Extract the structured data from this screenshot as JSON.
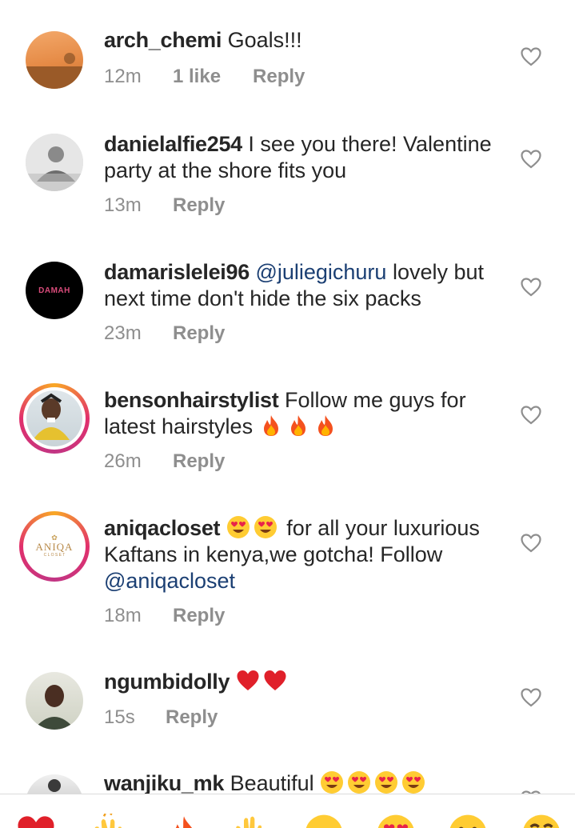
{
  "comments": [
    {
      "username": "arch_chemi",
      "text": "Goals!!!",
      "time": "12m",
      "likes": "1 like",
      "reply": "Reply"
    },
    {
      "username": "danielalfie254",
      "text": "I see you there! Valentine party at the shore fits you",
      "time": "13m",
      "reply": "Reply"
    },
    {
      "username": "damarislelei96",
      "mention": "@juliegichuru",
      "text": "lovely but next time don't hide the six packs",
      "time": "23m",
      "reply": "Reply",
      "avatar_label": "DAMAH"
    },
    {
      "username": "bensonhairstylist",
      "text": "Follow me guys for latest hairstyles",
      "time": "26m",
      "reply": "Reply"
    },
    {
      "username": "aniqacloset",
      "text": "for all your luxurious Kaftans in kenya,we gotcha! Follow",
      "mention": "@aniqacloset",
      "time": "18m",
      "reply": "Reply",
      "avatar_label": "ANIQA",
      "avatar_sub": "C L O S E T"
    },
    {
      "username": "ngumbidolly",
      "time": "15s",
      "reply": "Reply"
    },
    {
      "username": "wanjiku_mk",
      "text": "Beautiful"
    }
  ],
  "colors": {
    "mention": "#1b3f73",
    "muted": "#8e8e8e",
    "text": "#262626",
    "heart_red": "#e0202a"
  },
  "emoji_bar": [
    "red-heart",
    "clapping-hands",
    "fire",
    "raising-hands",
    "crying-face",
    "heart-eyes-face",
    "surprised-face",
    "tears-of-joy-face"
  ]
}
